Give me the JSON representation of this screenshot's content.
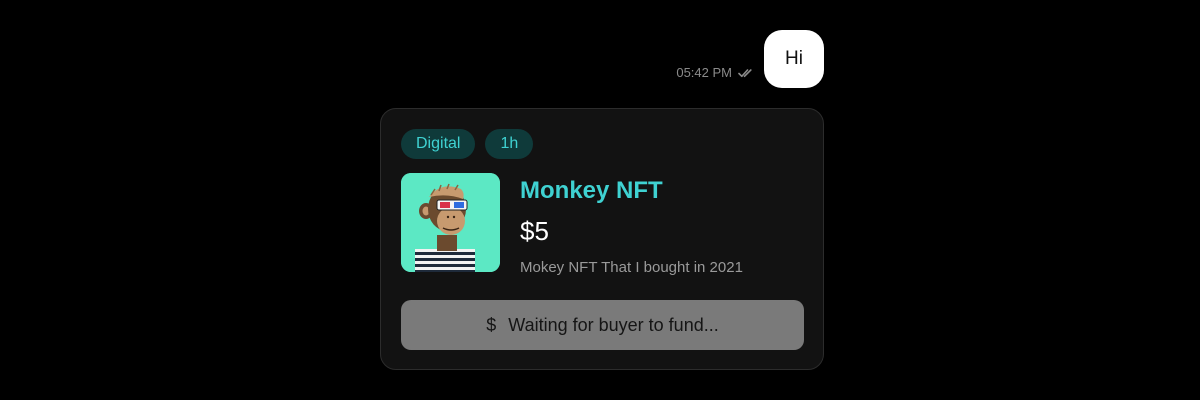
{
  "chat": {
    "message": {
      "text": "Hi",
      "time": "05:42 PM",
      "status_icon": "double-check-icon"
    }
  },
  "listing": {
    "tags": [
      "Digital",
      "1h"
    ],
    "title": "Monkey NFT",
    "price": "$5",
    "description": "Mokey NFT That I bought in 2021",
    "image_icon": "ape-nft-image",
    "status": {
      "icon": "dollar-icon",
      "icon_glyph": "$",
      "label": "Waiting for buyer to fund..."
    }
  },
  "colors": {
    "background": "#000000",
    "accent": "#3fd2d2",
    "tag_bg": "#0f3a3a",
    "card_bg": "#121212",
    "button_bg": "#7a7a7a",
    "image_bg": "#5ce8c4"
  }
}
